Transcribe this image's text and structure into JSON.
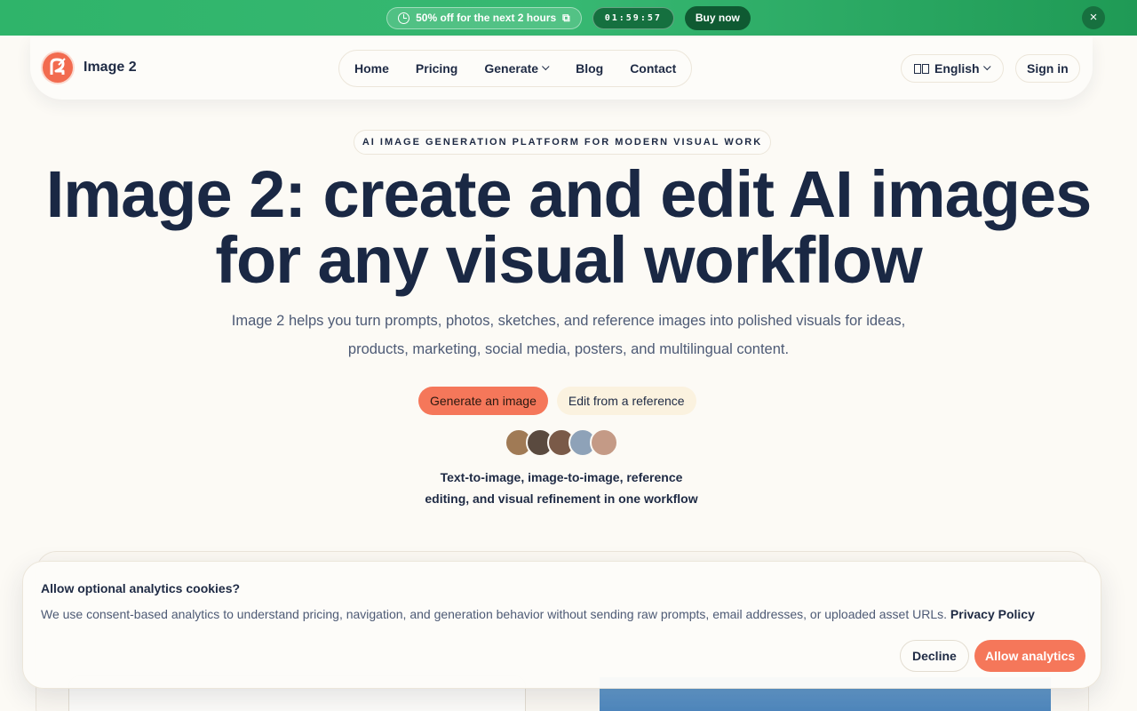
{
  "promo": {
    "offer": "50% off for the next 2 hours",
    "offer_suffix": "⧉",
    "timer": "01:59:57",
    "buy_label": "Buy now",
    "close_glyph": "×",
    "color": "#2fb46a"
  },
  "header": {
    "brand": "Image 2",
    "nav": [
      {
        "label": "Home"
      },
      {
        "label": "Pricing"
      },
      {
        "label": "Generate",
        "has_dropdown": true
      },
      {
        "label": "Blog"
      },
      {
        "label": "Contact"
      }
    ],
    "language": "English",
    "signin": "Sign in"
  },
  "hero": {
    "eyebrow": "AI IMAGE GENERATION PLATFORM FOR MODERN VISUAL WORK",
    "title": "Image 2: create and edit AI images for any visual workflow",
    "subtitle": "Image 2 helps you turn prompts, photos, sketches, and reference images into polished visuals for ideas, products, marketing, social media, posters, and multilingual content.",
    "cta_primary": "Generate an image",
    "cta_secondary": "Edit from a reference",
    "tagline": "Text-to-image, image-to-image, reference editing, and visual refinement in one workflow",
    "avatar_colors": [
      "#a07a55",
      "#5a4a3f",
      "#7a5a48",
      "#8ea2b8",
      "#c49a86"
    ]
  },
  "cookie": {
    "title": "Allow optional analytics cookies?",
    "text": "We use consent-based analytics to understand pricing, navigation, and generation behavior without sending raw prompts, email addresses, or uploaded asset URLs.",
    "link": "Privacy Policy",
    "decline": "Decline",
    "allow": "Allow analytics"
  },
  "colors": {
    "accent": "#f5775a",
    "text": "#1e2a44",
    "background": "#fcfaf5"
  }
}
